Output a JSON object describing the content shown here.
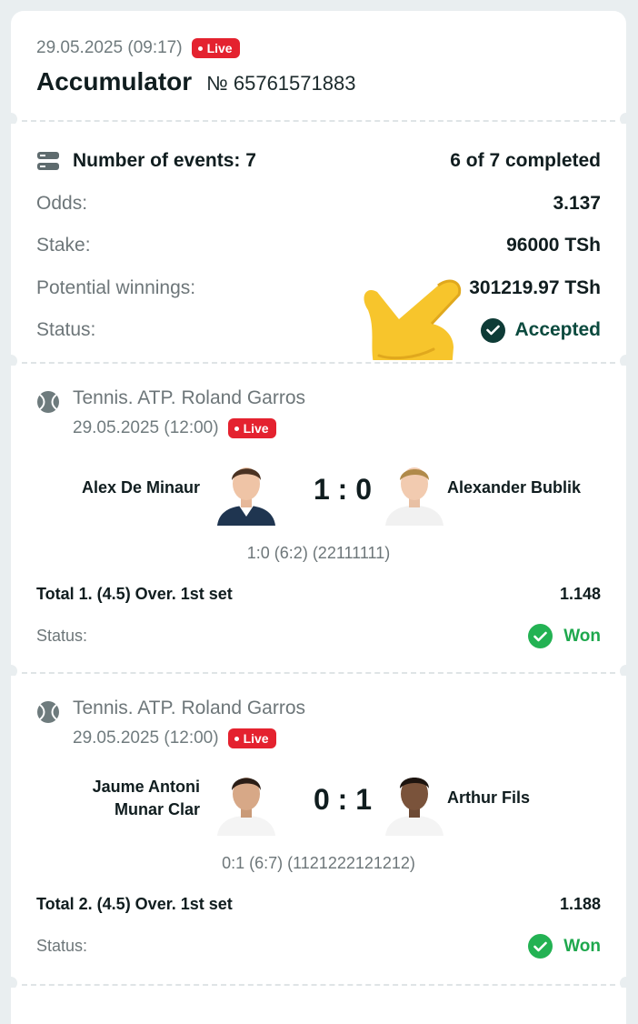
{
  "header": {
    "datetime": "29.05.2025 (09:17)",
    "live_badge": "Live",
    "title": "Accumulator",
    "bet_number": "№ 65761571883"
  },
  "summary": {
    "events_label": "Number of events: 7",
    "completed": "6 of 7 completed",
    "odds_label": "Odds:",
    "odds_value": "3.137",
    "stake_label": "Stake:",
    "stake_value": "96000 TSh",
    "winnings_label": "Potential winnings:",
    "winnings_value": "301219.97 TSh",
    "status_label": "Status:",
    "status_value": "Accepted"
  },
  "events": [
    {
      "competition": "Tennis. ATP. Roland Garros",
      "datetime": "29.05.2025 (12:00)",
      "live_badge": "Live",
      "player1": "Alex De Minaur",
      "player2": "Alexander Bublik",
      "score": "1 : 0",
      "detail": "1:0 (6:2) (22111111)",
      "market": "Total 1. (4.5) Over. 1st set",
      "odds": "1.148",
      "status_label": "Status:",
      "status": "Won"
    },
    {
      "competition": "Tennis. ATP. Roland Garros",
      "datetime": "29.05.2025 (12:00)",
      "live_badge": "Live",
      "player1": "Jaume Antoni Munar Clar",
      "player2": "Arthur Fils",
      "score": "0 : 1",
      "detail": "0:1 (6:7) (1121222121212)",
      "market": "Total 2. (4.5) Over. 1st set",
      "odds": "1.188",
      "status_label": "Status:",
      "status": "Won"
    }
  ],
  "colors": {
    "live": "#e4222f",
    "won": "#23b253",
    "accepted": "#0e3b36"
  }
}
